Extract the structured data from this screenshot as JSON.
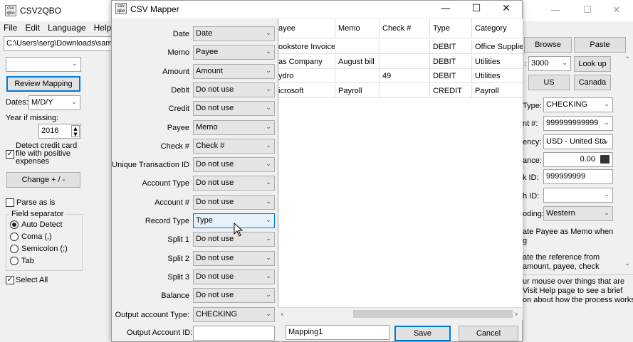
{
  "main": {
    "title": "CSV2QBO",
    "menu": [
      "File",
      "Edit",
      "Language",
      "Help"
    ],
    "path": "C:\\Users\\serg\\Downloads\\sampl",
    "browse": "Browse",
    "paste": "Paste",
    "review_mapping": "Review Mapping",
    "dates_label": "Dates:",
    "dates_value": "M/D/Y",
    "year_label": "Year if missing:",
    "year_value": "2016",
    "detect_label": "Detect credit card file with positive expenses",
    "change_button": "Change + / -",
    "parse_as_is": "Parse as is",
    "field_separator": "Field separator",
    "separators": [
      "Auto Detect",
      "Coma (,)",
      "Semicolon (;)",
      "Tab"
    ],
    "select_all": "Select All",
    "right": {
      "num_value": "3000",
      "lookup": "Look up",
      "us": "US",
      "canada": "Canada",
      "type_label": "Type:",
      "type_value": "CHECKING",
      "acct_label": "nt #:",
      "acct_value": "999999999999",
      "currency_label": "ency:",
      "currency_value": "USD - United Sta",
      "balance_label": "ance:",
      "balance_value": "0.00",
      "bankid_label": "k ID:",
      "bankid_value": "999999999",
      "branch_label": "h ID:",
      "coding_label": "oding:",
      "coding_value": "Western",
      "note1": "ate Payee as Memo when",
      "note1b": "g",
      "note2": "ate the reference from",
      "note2b": "amount, payee, check",
      "hint1": "ur mouse over things that are",
      "hint2": "Visit Help page to see a brief",
      "hint3": "on about how the process works",
      "num_prefix": ":"
    }
  },
  "dialog": {
    "title": "CSV Mapper",
    "rows": [
      {
        "label": "Date",
        "value": "Date"
      },
      {
        "label": "Memo",
        "value": "Payee"
      },
      {
        "label": "Amount",
        "value": "Amount"
      },
      {
        "label": "Debit",
        "value": "Do not use"
      },
      {
        "label": "Credit",
        "value": "Do not use"
      },
      {
        "label": "Payee",
        "value": "Memo"
      },
      {
        "label": "Check #",
        "value": "Check #"
      },
      {
        "label": "Unique Transaction ID",
        "value": "Do not use"
      },
      {
        "label": "Account Type",
        "value": "Do not use"
      },
      {
        "label": "Account #",
        "value": "Do not use"
      },
      {
        "label": "Record Type",
        "value": "Type"
      },
      {
        "label": "Split 1",
        "value": "Do not use"
      },
      {
        "label": "Split 2",
        "value": "Do not use"
      },
      {
        "label": "Split 3",
        "value": "Do not use"
      },
      {
        "label": "Balance",
        "value": "Do not use"
      },
      {
        "label": "Output account Type:",
        "value": "CHECKING"
      }
    ],
    "output_account_id_label": "Output Account ID:",
    "output_account_id_value": "",
    "mapping_name": "Mapping1",
    "save": "Save",
    "cancel": "Cancel",
    "grid": {
      "columns": [
        "ayee",
        "Memo",
        "Check #",
        "Type",
        "Category"
      ],
      "rows": [
        [
          "ookstore Invoice",
          "",
          "",
          "DEBIT",
          "Office Supplies"
        ],
        [
          "as Company",
          "August bill",
          "",
          "DEBIT",
          "Utilities"
        ],
        [
          "ydro",
          "",
          "49",
          "DEBIT",
          "Utilities"
        ],
        [
          "icrosoft",
          "Payroll",
          "",
          "CREDIT",
          "Payroll"
        ]
      ]
    }
  }
}
